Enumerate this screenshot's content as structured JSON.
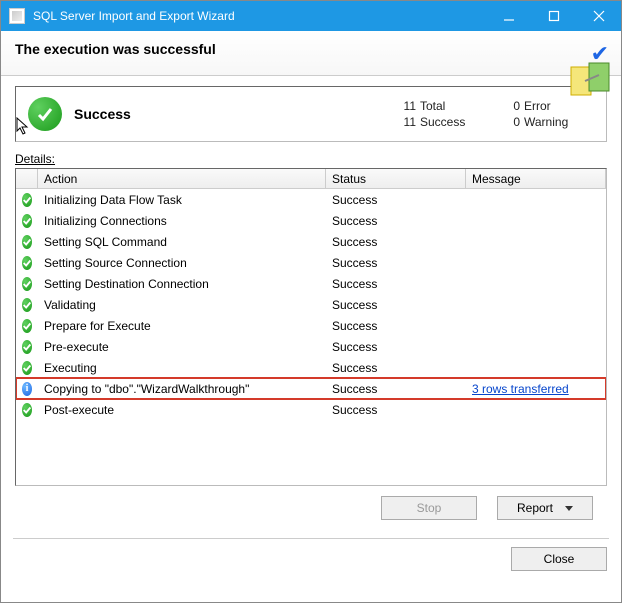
{
  "window": {
    "title": "SQL Server Import and Export Wizard"
  },
  "header": {
    "heading": "The execution was successful"
  },
  "summary": {
    "status": "Success",
    "total_count": "11",
    "total_label": "Total",
    "success_count": "11",
    "success_label": "Success",
    "error_count": "0",
    "error_label": "Error",
    "warning_count": "0",
    "warning_label": "Warning"
  },
  "details": {
    "label": "Details:",
    "columns": {
      "action": "Action",
      "status": "Status",
      "message": "Message"
    },
    "rows": [
      {
        "icon": "success",
        "action": "Initializing Data Flow Task",
        "status": "Success",
        "message": ""
      },
      {
        "icon": "success",
        "action": "Initializing Connections",
        "status": "Success",
        "message": ""
      },
      {
        "icon": "success",
        "action": "Setting SQL Command",
        "status": "Success",
        "message": ""
      },
      {
        "icon": "success",
        "action": "Setting Source Connection",
        "status": "Success",
        "message": ""
      },
      {
        "icon": "success",
        "action": "Setting Destination Connection",
        "status": "Success",
        "message": ""
      },
      {
        "icon": "success",
        "action": "Validating",
        "status": "Success",
        "message": ""
      },
      {
        "icon": "success",
        "action": "Prepare for Execute",
        "status": "Success",
        "message": ""
      },
      {
        "icon": "success",
        "action": "Pre-execute",
        "status": "Success",
        "message": ""
      },
      {
        "icon": "success",
        "action": "Executing",
        "status": "Success",
        "message": ""
      },
      {
        "icon": "info",
        "action": "Copying to \"dbo\".\"WizardWalkthrough\"",
        "status": "Success",
        "message": "3 rows transferred",
        "highlight": true,
        "link": true
      },
      {
        "icon": "success",
        "action": "Post-execute",
        "status": "Success",
        "message": ""
      }
    ]
  },
  "buttons": {
    "stop": "Stop",
    "report": "Report",
    "close": "Close"
  }
}
